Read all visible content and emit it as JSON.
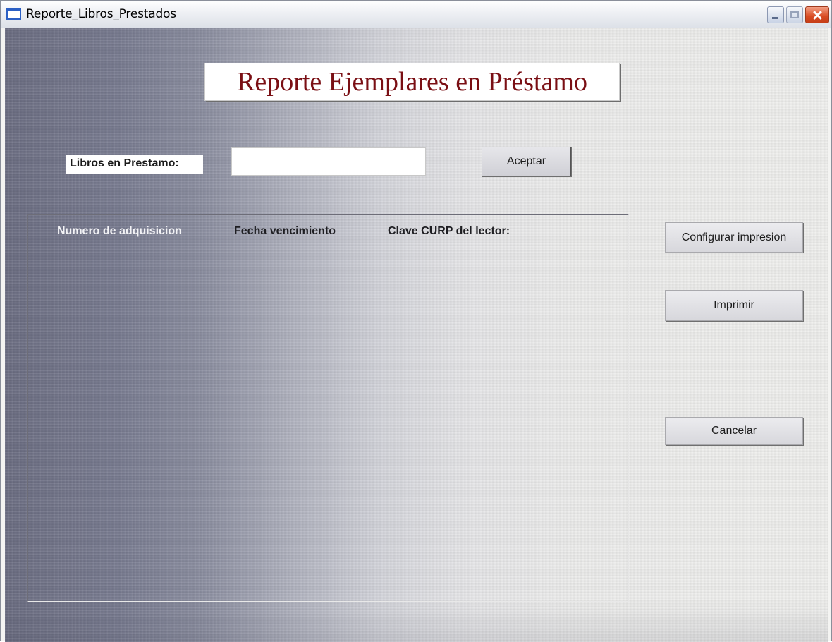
{
  "window": {
    "title": "Reporte_Libros_Prestados",
    "close_color": "#d84b22",
    "icon": "window-icon"
  },
  "header": {
    "title": "Reporte Ejemplares en Préstamo",
    "title_color": "#7a0f14"
  },
  "form": {
    "libros_label": "Libros en Prestamo:",
    "libros_value": "",
    "aceptar_label": "Aceptar"
  },
  "list": {
    "columns": [
      "Numero de adquisicion",
      "Fecha vencimiento",
      "Clave CURP del lector:"
    ],
    "rows": []
  },
  "actions": {
    "configurar_label": "Configurar impresion",
    "imprimir_label": "Imprimir",
    "cancelar_label": "Cancelar"
  }
}
